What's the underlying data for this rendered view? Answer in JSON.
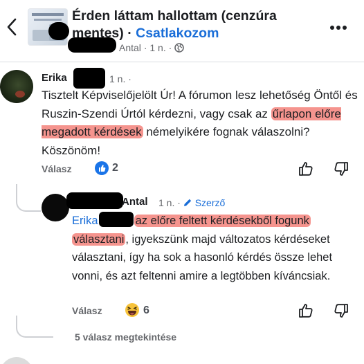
{
  "header": {
    "group_title": "Érden láttam hallottam (cenzúra mentes)",
    "separator": "·",
    "join_label": "Csatlakozom",
    "meta_author": "Antal",
    "meta_time": "1 n.",
    "meta_dot": "·",
    "audience_icon": "globe-icon"
  },
  "comment1": {
    "author": "Erika",
    "time": "1 n.",
    "dot": "·",
    "text_before": "Tisztelt Képviselőjelölt Úr! A fórumon lesz lehetőség Öntől és Ruszin-Szendi Úrtól kérdezni, vagy csak az ",
    "text_highlight": "űrlapon előre megadott kérdések",
    "text_after": " némelyikére fognak válaszolni? Köszönöm!",
    "reply_label": "Válasz",
    "reaction_icon": "like-icon",
    "reaction_count": "2"
  },
  "comment2": {
    "author": "Antal",
    "time": "1 n.",
    "dot": "·",
    "author_badge": "Szerző",
    "mention": "Erika",
    "text_highlight_1": "az előre feltett kérdésekből fogunk",
    "text_highlight_2": "választani",
    "text_rest": ", igyekszünk majd változatos kérdéseket választani, így ha sok a hasonló kérdés össze lehet vonni, és azt feltenni amire a legtöbben kíváncsiak.",
    "reply_label": "Válasz",
    "reaction_icon": "haha-icon",
    "reaction_count": "6"
  },
  "more_replies": "5 válasz megtekintése",
  "colors": {
    "link_blue": "#1a6ed8",
    "highlight": "#f5948e",
    "secondary_text": "#65676b"
  }
}
